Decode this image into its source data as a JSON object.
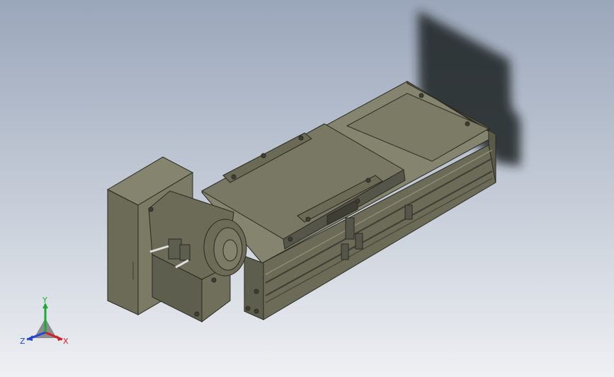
{
  "viewport": {
    "background_top": "#9aa6ba",
    "background_bottom": "#eef0f3",
    "model_color": "#6b6b58",
    "model_dark": "#3e3e34",
    "model_light": "#85856f",
    "shadow_color": "#1e2024"
  },
  "triad": {
    "x_label": "X",
    "y_label": "Y",
    "z_label": "Z",
    "x_color": "#d0202a",
    "y_color": "#1fa83a",
    "z_color": "#2446d6"
  }
}
